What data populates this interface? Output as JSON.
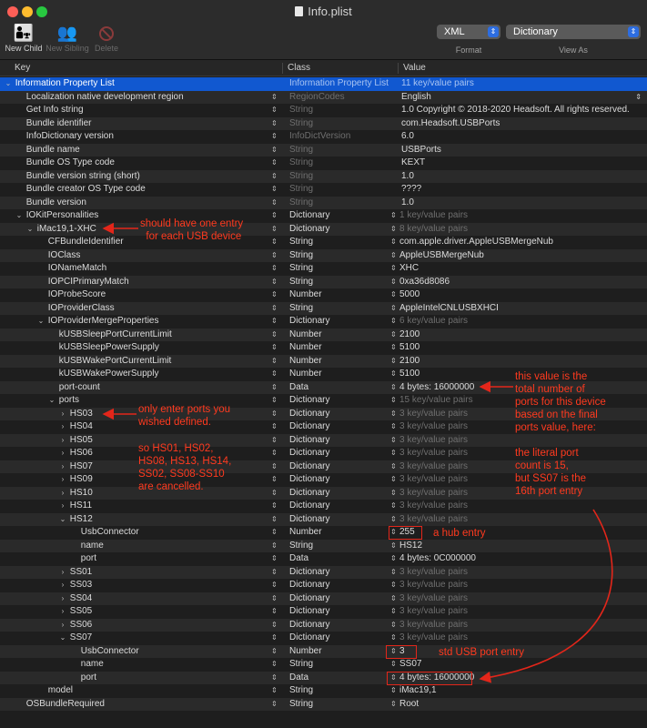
{
  "window": {
    "title": "Info.plist"
  },
  "toolbar": {
    "new_child": "New Child",
    "new_sibling": "New Sibling",
    "delete": "Delete",
    "format_value": "XML",
    "format_label": "Format",
    "view_value": "Dictionary",
    "view_label": "View As"
  },
  "columns": {
    "key": "Key",
    "class": "Class",
    "value": "Value"
  },
  "rows": [
    {
      "key": "Information Property List",
      "indent": 0,
      "tri": "down",
      "class": "Information Property List",
      "value": "11 key/value pairs",
      "dim": true,
      "selected": true
    },
    {
      "key": "Localization native development region",
      "indent": 1,
      "tri": "",
      "class": "RegionCodes",
      "value": "English",
      "dim_class": true,
      "popup": true
    },
    {
      "key": "Get Info string",
      "indent": 1,
      "tri": "",
      "class": "String",
      "value": "1.0 Copyright © 2018-2020 Headsoft. All rights reserved.",
      "dim_class": true
    },
    {
      "key": "Bundle identifier",
      "indent": 1,
      "tri": "",
      "class": "String",
      "value": "com.Headsoft.USBPorts",
      "dim_class": true
    },
    {
      "key": "InfoDictionary version",
      "indent": 1,
      "tri": "",
      "class": "InfoDictVersion",
      "value": "6.0",
      "dim_class": true
    },
    {
      "key": "Bundle name",
      "indent": 1,
      "tri": "",
      "class": "String",
      "value": "USBPorts",
      "dim_class": true
    },
    {
      "key": "Bundle OS Type code",
      "indent": 1,
      "tri": "",
      "class": "String",
      "value": "KEXT",
      "dim_class": true
    },
    {
      "key": "Bundle version string (short)",
      "indent": 1,
      "tri": "",
      "class": "String",
      "value": "1.0",
      "dim_class": true
    },
    {
      "key": "Bundle creator OS Type code",
      "indent": 1,
      "tri": "",
      "class": "String",
      "value": "????",
      "dim_class": true
    },
    {
      "key": "Bundle version",
      "indent": 1,
      "tri": "",
      "class": "String",
      "value": "1.0",
      "dim_class": true
    },
    {
      "key": "IOKitPersonalities",
      "indent": 1,
      "tri": "down",
      "class": "Dictionary",
      "value": "1 key/value pairs",
      "dim": true,
      "vstep": true
    },
    {
      "key": "iMac19,1-XHC",
      "indent": 2,
      "tri": "down",
      "class": "Dictionary",
      "value": "8 key/value pairs",
      "dim": true,
      "vstep": true
    },
    {
      "key": "CFBundleIdentifier",
      "indent": 3,
      "tri": "",
      "class": "String",
      "value": "com.apple.driver.AppleUSBMergeNub",
      "vstep": true
    },
    {
      "key": "IOClass",
      "indent": 3,
      "tri": "",
      "class": "String",
      "value": "AppleUSBMergeNub",
      "vstep": true
    },
    {
      "key": "IONameMatch",
      "indent": 3,
      "tri": "",
      "class": "String",
      "value": "XHC",
      "vstep": true
    },
    {
      "key": "IOPCIPrimaryMatch",
      "indent": 3,
      "tri": "",
      "class": "String",
      "value": "0xa36d8086",
      "vstep": true
    },
    {
      "key": "IOProbeScore",
      "indent": 3,
      "tri": "",
      "class": "Number",
      "value": "5000",
      "vstep": true
    },
    {
      "key": "IOProviderClass",
      "indent": 3,
      "tri": "",
      "class": "String",
      "value": "AppleIntelCNLUSBXHCI",
      "vstep": true
    },
    {
      "key": "IOProviderMergeProperties",
      "indent": 3,
      "tri": "down",
      "class": "Dictionary",
      "value": "6 key/value pairs",
      "dim": true,
      "vstep": true
    },
    {
      "key": "kUSBSleepPortCurrentLimit",
      "indent": 4,
      "tri": "",
      "class": "Number",
      "value": "2100",
      "vstep": true
    },
    {
      "key": "kUSBSleepPowerSupply",
      "indent": 4,
      "tri": "",
      "class": "Number",
      "value": "5100",
      "vstep": true
    },
    {
      "key": "kUSBWakePortCurrentLimit",
      "indent": 4,
      "tri": "",
      "class": "Number",
      "value": "2100",
      "vstep": true
    },
    {
      "key": "kUSBWakePowerSupply",
      "indent": 4,
      "tri": "",
      "class": "Number",
      "value": "5100",
      "vstep": true
    },
    {
      "key": "port-count",
      "indent": 4,
      "tri": "",
      "class": "Data",
      "value": "4 bytes: 16000000",
      "vstep": true
    },
    {
      "key": "ports",
      "indent": 4,
      "tri": "down",
      "class": "Dictionary",
      "value": "15 key/value pairs",
      "dim": true,
      "vstep": true
    },
    {
      "key": "HS03",
      "indent": 5,
      "tri": "right",
      "class": "Dictionary",
      "value": "3 key/value pairs",
      "dim": true,
      "vstep": true
    },
    {
      "key": "HS04",
      "indent": 5,
      "tri": "right",
      "class": "Dictionary",
      "value": "3 key/value pairs",
      "dim": true,
      "vstep": true
    },
    {
      "key": "HS05",
      "indent": 5,
      "tri": "right",
      "class": "Dictionary",
      "value": "3 key/value pairs",
      "dim": true,
      "vstep": true
    },
    {
      "key": "HS06",
      "indent": 5,
      "tri": "right",
      "class": "Dictionary",
      "value": "3 key/value pairs",
      "dim": true,
      "vstep": true
    },
    {
      "key": "HS07",
      "indent": 5,
      "tri": "right",
      "class": "Dictionary",
      "value": "3 key/value pairs",
      "dim": true,
      "vstep": true
    },
    {
      "key": "HS09",
      "indent": 5,
      "tri": "right",
      "class": "Dictionary",
      "value": "3 key/value pairs",
      "dim": true,
      "vstep": true
    },
    {
      "key": "HS10",
      "indent": 5,
      "tri": "right",
      "class": "Dictionary",
      "value": "3 key/value pairs",
      "dim": true,
      "vstep": true
    },
    {
      "key": "HS11",
      "indent": 5,
      "tri": "right",
      "class": "Dictionary",
      "value": "3 key/value pairs",
      "dim": true,
      "vstep": true
    },
    {
      "key": "HS12",
      "indent": 5,
      "tri": "down",
      "class": "Dictionary",
      "value": "3 key/value pairs",
      "dim": true,
      "vstep": true
    },
    {
      "key": "UsbConnector",
      "indent": 6,
      "tri": "",
      "class": "Number",
      "value": "255",
      "vstep": true
    },
    {
      "key": "name",
      "indent": 6,
      "tri": "",
      "class": "String",
      "value": "HS12",
      "vstep": true
    },
    {
      "key": "port",
      "indent": 6,
      "tri": "",
      "class": "Data",
      "value": "4 bytes: 0C000000",
      "vstep": true
    },
    {
      "key": "SS01",
      "indent": 5,
      "tri": "right",
      "class": "Dictionary",
      "value": "3 key/value pairs",
      "dim": true,
      "vstep": true
    },
    {
      "key": "SS03",
      "indent": 5,
      "tri": "right",
      "class": "Dictionary",
      "value": "3 key/value pairs",
      "dim": true,
      "vstep": true
    },
    {
      "key": "SS04",
      "indent": 5,
      "tri": "right",
      "class": "Dictionary",
      "value": "3 key/value pairs",
      "dim": true,
      "vstep": true
    },
    {
      "key": "SS05",
      "indent": 5,
      "tri": "right",
      "class": "Dictionary",
      "value": "3 key/value pairs",
      "dim": true,
      "vstep": true
    },
    {
      "key": "SS06",
      "indent": 5,
      "tri": "right",
      "class": "Dictionary",
      "value": "3 key/value pairs",
      "dim": true,
      "vstep": true
    },
    {
      "key": "SS07",
      "indent": 5,
      "tri": "down",
      "class": "Dictionary",
      "value": "3 key/value pairs",
      "dim": true,
      "vstep": true
    },
    {
      "key": "UsbConnector",
      "indent": 6,
      "tri": "",
      "class": "Number",
      "value": "3",
      "vstep": true
    },
    {
      "key": "name",
      "indent": 6,
      "tri": "",
      "class": "String",
      "value": "SS07",
      "vstep": true
    },
    {
      "key": "port",
      "indent": 6,
      "tri": "",
      "class": "Data",
      "value": "4 bytes: 16000000",
      "vstep": true
    },
    {
      "key": "model",
      "indent": 3,
      "tri": "",
      "class": "String",
      "value": "iMac19,1",
      "vstep": true
    },
    {
      "key": "OSBundleRequired",
      "indent": 1,
      "tri": "",
      "class": "String",
      "value": "Root",
      "vstep": true
    }
  ],
  "annotations": {
    "one_entry": "should have one entry\n  for each USB device",
    "only_ports": "only enter ports you\nwished defined.",
    "cancelled": "so HS01, HS02,\nHS08, HS13, HS14,\nSS02, SS08-SS10\nare cancelled.",
    "port_count": "this value is the\ntotal number of\nports for this device\nbased on the final\nports value, here:\n\nthe literal port\ncount is 15,\nbut SS07 is the\n16th port entry",
    "hub": "a hub entry",
    "std": "std USB port entry"
  },
  "colors": {
    "selection": "#1158d0",
    "annotation": "#ff3a1f"
  }
}
